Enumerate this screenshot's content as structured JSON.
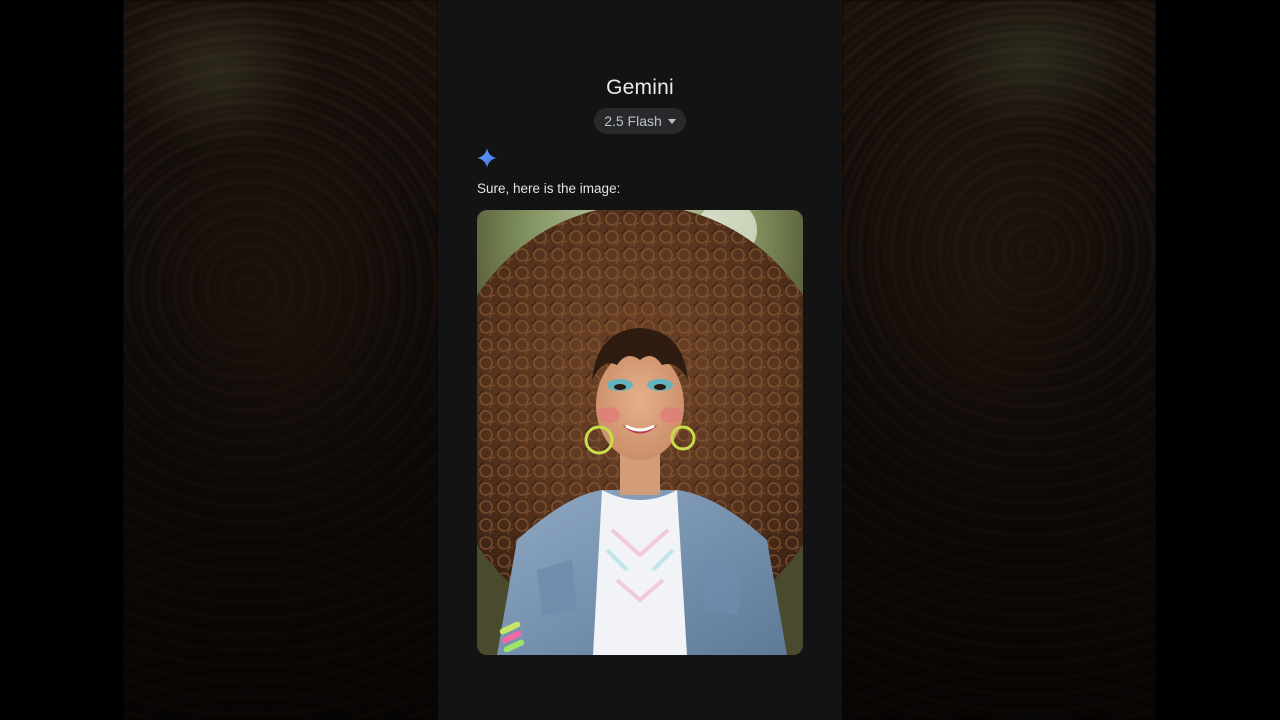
{
  "header": {
    "title": "Gemini",
    "model_selector": {
      "label": "2.5 Flash",
      "icon": "caret-down-icon"
    }
  },
  "response": {
    "avatar_icon": "gemini-sparkle-icon",
    "text": "Sure, here is the image:",
    "image_icon": "generated-portrait-image"
  },
  "colors": {
    "panel_bg": "#131314",
    "chip_bg": "#28292b",
    "sparkle_blue": "#4c8df6",
    "text_primary": "#e3e3e3"
  }
}
